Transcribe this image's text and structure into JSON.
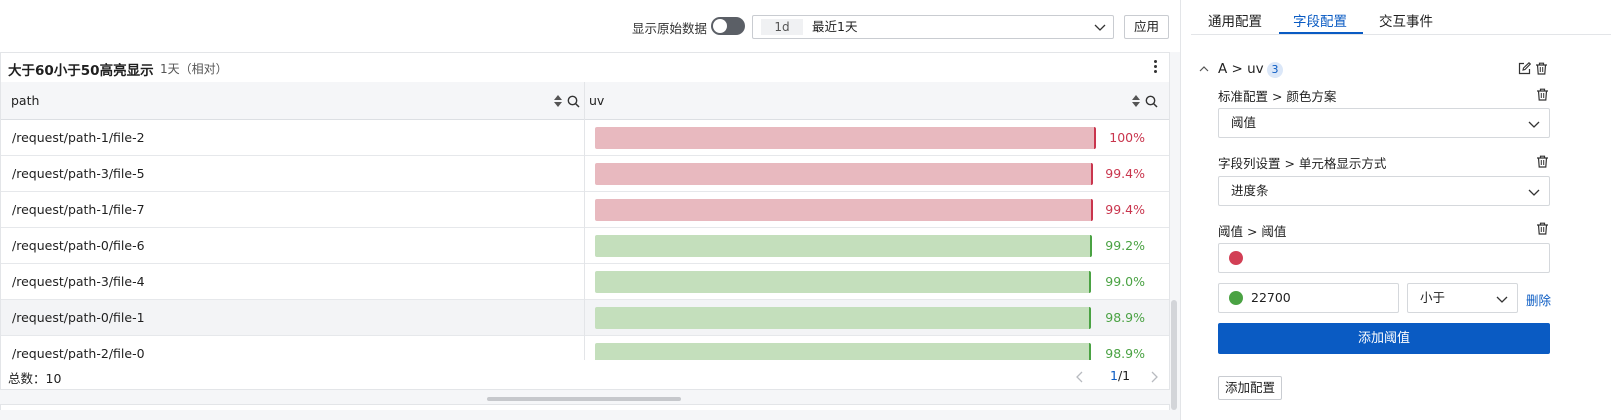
{
  "toolbar": {
    "raw_data_label": "显示原始数据",
    "raw_data_enabled": false,
    "time_badge": "1d",
    "time_value": "最近1天",
    "apply_label": "应用"
  },
  "panel": {
    "title": "大于60小于50高亮显示",
    "subtitle": "1天（相对）",
    "columns": [
      "path",
      "uv"
    ],
    "rows": [
      {
        "path": "/request/path-1/file-2",
        "value": 1.0,
        "label": "100%",
        "status": "red"
      },
      {
        "path": "/request/path-3/file-5",
        "value": 0.994,
        "label": "99.4%",
        "status": "red"
      },
      {
        "path": "/request/path-1/file-7",
        "value": 0.994,
        "label": "99.4%",
        "status": "red"
      },
      {
        "path": "/request/path-0/file-6",
        "value": 0.992,
        "label": "99.2%",
        "status": "green"
      },
      {
        "path": "/request/path-3/file-4",
        "value": 0.99,
        "label": "99.0%",
        "status": "green"
      },
      {
        "path": "/request/path-0/file-1",
        "value": 0.989,
        "label": "98.9%",
        "status": "green"
      },
      {
        "path": "/request/path-2/file-0",
        "value": 0.989,
        "label": "98.9%",
        "status": "green"
      }
    ],
    "total_label": "总数：",
    "total_value": "10",
    "page_current": "1",
    "page_total": "/1"
  },
  "config": {
    "tabs": [
      "通用配置",
      "字段配置",
      "交互事件"
    ],
    "active_tab": 1,
    "section_title": "A > uv",
    "section_count": "3",
    "color_scheme_label": "标准配置 > 颜色方案",
    "color_scheme_value": "阈值",
    "cell_display_label": "字段列设置 > 单元格显示方式",
    "cell_display_value": "进度条",
    "threshold_label": "阈值 > 阈值",
    "threshold_base_color": "#d23f55",
    "threshold_color": "#4aa243",
    "threshold_value": "22700",
    "threshold_operator": "小于",
    "delete_label": "删除",
    "add_threshold_label": "添加阈值",
    "add_config_label": "添加配置"
  },
  "colors": {
    "accent": "#0a5bc3",
    "red_bar": "#e8b9bf",
    "green_bar": "#c4dfbc"
  }
}
